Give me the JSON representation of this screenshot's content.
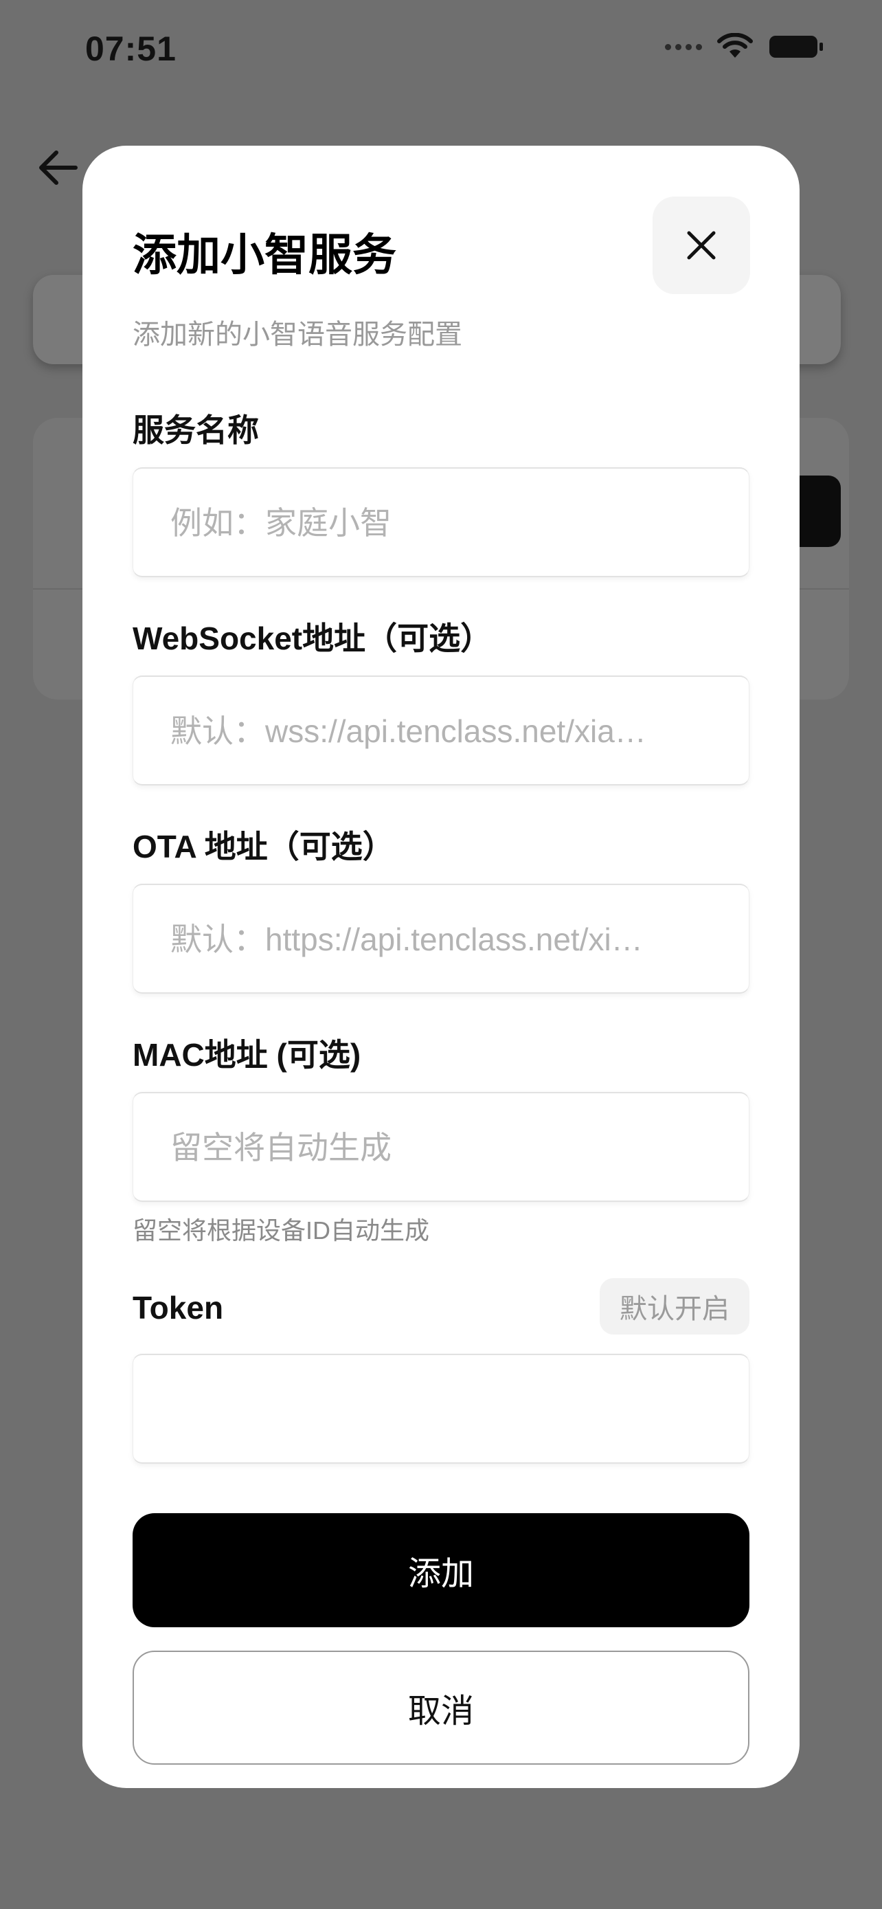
{
  "status_bar": {
    "time": "07:51"
  },
  "modal": {
    "title": "添加小智服务",
    "subtitle": "添加新的小智语音服务配置",
    "fields": {
      "name": {
        "label": "服务名称",
        "placeholder": "例如：家庭小智",
        "value": ""
      },
      "websocket": {
        "label": "WebSocket地址（可选）",
        "placeholder": "默认：wss://api.tenclass.net/xia…",
        "value": ""
      },
      "ota": {
        "label": "OTA 地址（可选）",
        "placeholder": "默认：https://api.tenclass.net/xi…",
        "value": ""
      },
      "mac": {
        "label": "MAC地址 (可选)",
        "placeholder": "留空将自动生成",
        "helper": "留空将根据设备ID自动生成",
        "value": ""
      },
      "token": {
        "label": "Token",
        "badge": "默认开启",
        "value": ""
      }
    },
    "add_button": "添加",
    "cancel_button": "取消"
  },
  "icons": [
    "back-arrow-icon",
    "close-icon",
    "signal-dots-icon",
    "wifi-icon",
    "battery-icon"
  ]
}
